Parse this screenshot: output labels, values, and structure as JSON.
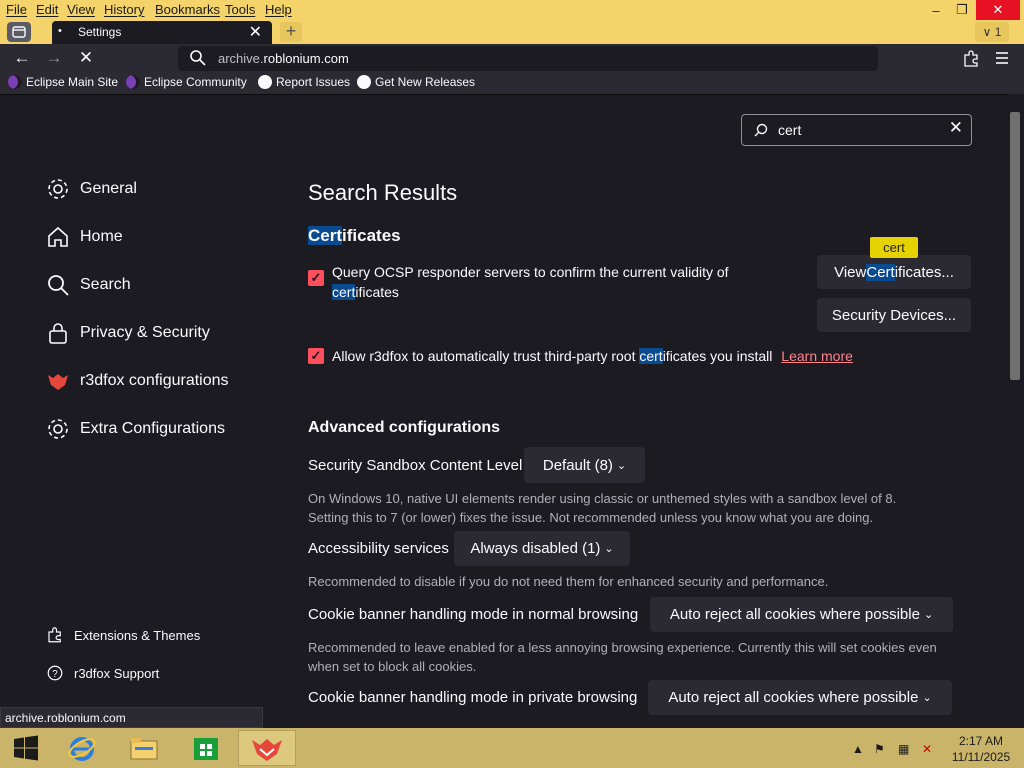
{
  "menu": [
    "File",
    "Edit",
    "View",
    "History",
    "Bookmarks",
    "Tools",
    "Help"
  ],
  "tab": {
    "dot": "•",
    "title": "Settings",
    "close": "✕"
  },
  "newtab": "+",
  "tabcount": "∨ 1",
  "window_controls": {
    "minimize": "–",
    "restore": "❐",
    "close": "✕"
  },
  "toolbar": {
    "back": "←",
    "forward": "→",
    "stop": "✕",
    "url_dim": "archive.",
    "url_main": "roblonium.com"
  },
  "bookmarks": [
    {
      "label": "Eclipse Main Site",
      "icon": "eclipse-icon"
    },
    {
      "label": "Eclipse Community",
      "icon": "eclipse-icon"
    },
    {
      "label": "Report Issues",
      "icon": "github-icon"
    },
    {
      "label": "Get New Releases",
      "icon": "github-icon"
    }
  ],
  "sidebar": {
    "items": [
      {
        "label": "General",
        "icon": "gear-icon"
      },
      {
        "label": "Home",
        "icon": "home-icon"
      },
      {
        "label": "Search",
        "icon": "search-icon"
      },
      {
        "label": "Privacy & Security",
        "icon": "lock-icon"
      },
      {
        "label": "r3dfox configurations",
        "icon": "fox-icon"
      },
      {
        "label": "Extra Configurations",
        "icon": "gear-icon"
      }
    ],
    "footer": [
      {
        "label": "Extensions & Themes",
        "icon": "puzzle-icon"
      },
      {
        "label": "r3dfox Support",
        "icon": "help-icon"
      }
    ]
  },
  "search": {
    "value": "cert",
    "clear": "✕"
  },
  "main": {
    "heading": "Search Results",
    "cert_section": {
      "title_hl": "Cert",
      "title_rest": "ificates"
    },
    "ocsp": {
      "line1": "Query OCSP responder servers to confirm the current validity of",
      "line2_hl": "cert",
      "line2_rest": "ificates",
      "checked": true
    },
    "view_cert_btn": {
      "pre": "View ",
      "hl": "Cert",
      "post": "ificates..."
    },
    "tooltip": "cert",
    "security_devices_btn": "Security Devices...",
    "trust": {
      "pre": "Allow r3dfox to automatically trust third-party root ",
      "hl": "cert",
      "post": "ificates you install",
      "link": "Learn more",
      "checked": true
    },
    "advanced": {
      "title": "Advanced configurations",
      "sandbox": {
        "label": "Security Sandbox Content Level",
        "value": "Default (8)",
        "desc1": "On Windows 10, native UI elements render using classic or unthemed styles with a sandbox level of 8.",
        "desc2": "Setting this to 7 (or lower) fixes the issue. Not recommended unless you know what you are doing."
      },
      "a11y": {
        "label": "Accessibility services",
        "value": "Always disabled (1)",
        "desc": "Recommended to disable if you do not need them for enhanced security and performance."
      },
      "cookie_normal": {
        "label": "Cookie banner handling mode in normal browsing",
        "value": "Auto reject all cookies where possible",
        "desc1": "Recommended to leave enabled for a less annoying browsing experience. Currently this will set cookies even",
        "desc2": "when set to block all cookies."
      },
      "cookie_private": {
        "label": "Cookie banner handling mode in private browsing",
        "value": "Auto reject all cookies where possible"
      }
    }
  },
  "status": "archive.roblonium.com",
  "taskbar": {
    "time": "2:17 AM",
    "date": "11/11/2025",
    "apps": [
      "start-icon",
      "ie-icon",
      "explorer-icon",
      "store-icon",
      "r3dfox-icon"
    ]
  },
  "colors": {
    "accent": "#ff4f5e",
    "highlight": "#0a4b8f",
    "topband": "#f3d36a",
    "taskbar": "#c9b469"
  }
}
